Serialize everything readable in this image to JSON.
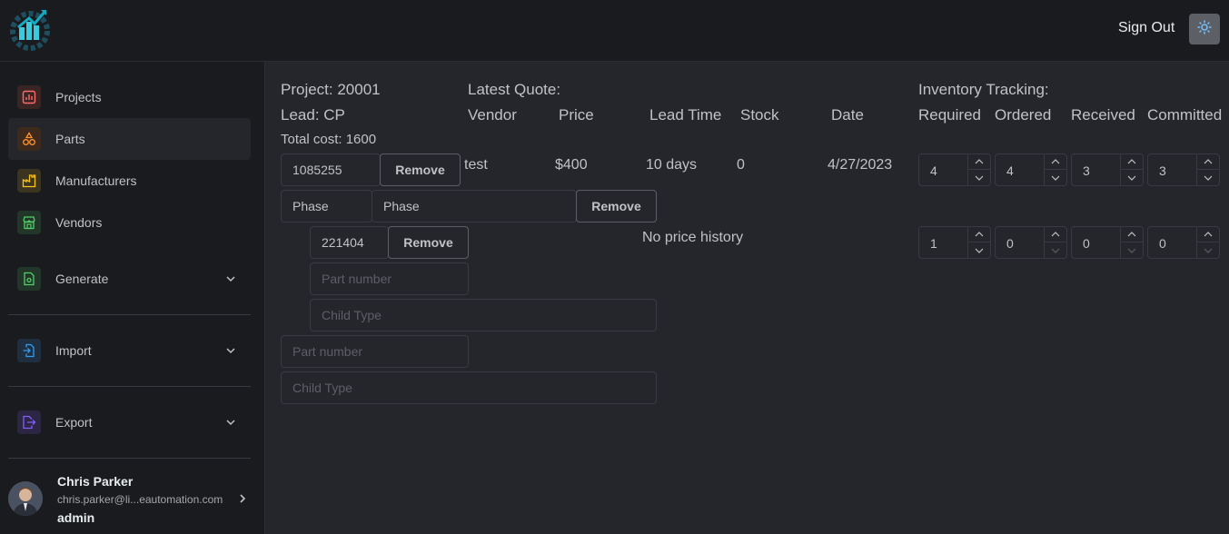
{
  "header": {
    "sign_out": "Sign Out",
    "theme_icon": "sun-icon",
    "logo_icon": "gauge-gear-logo"
  },
  "sidebar": {
    "items": [
      {
        "label": "Projects",
        "icon": "chart-icon",
        "color": "#ff6b6b"
      },
      {
        "label": "Parts",
        "icon": "shapes-icon",
        "color": "#ff922b"
      },
      {
        "label": "Manufacturers",
        "icon": "factory-icon",
        "color": "#fcc419"
      },
      {
        "label": "Vendors",
        "icon": "store-icon",
        "color": "#51cf66"
      },
      {
        "label": "Generate",
        "icon": "file-gear-icon",
        "color": "#51cf66"
      },
      {
        "label": "Import",
        "icon": "file-import-icon",
        "color": "#339af0"
      },
      {
        "label": "Export",
        "icon": "file-export-icon",
        "color": "#845ef7"
      }
    ],
    "user": {
      "name": "Chris Parker",
      "email": "chris.parker@li...eautomation.com",
      "role": "admin"
    }
  },
  "main": {
    "project": "Project: 20001",
    "lead": "Lead: CP",
    "total_cost": "Total cost: 1600",
    "latest_quote": "Latest Quote:",
    "inventory_tracking": "Inventory Tracking:",
    "cols": {
      "vendor": "Vendor",
      "price": "Price",
      "lead_time": "Lead Time",
      "stock": "Stock",
      "date": "Date",
      "required": "Required",
      "ordered": "Ordered",
      "received": "Received",
      "committed": "Committed"
    },
    "row1": {
      "part": "1085255",
      "remove": "Remove",
      "vendor": "test",
      "price": "$400",
      "lead_time": "10 days",
      "stock": "0",
      "date": "4/27/2023",
      "required": "4",
      "ordered": "4",
      "received": "3",
      "committed": "3"
    },
    "phase_row": {
      "phase_a": "Phase",
      "phase_b": "Phase",
      "remove": "Remove"
    },
    "row2": {
      "part": "221404",
      "remove": "Remove",
      "no_history": "No price history",
      "required": "1",
      "ordered": "0",
      "received": "0",
      "committed": "0"
    },
    "placeholders": {
      "part_number": "Part number",
      "child_type": "Child Type"
    }
  }
}
